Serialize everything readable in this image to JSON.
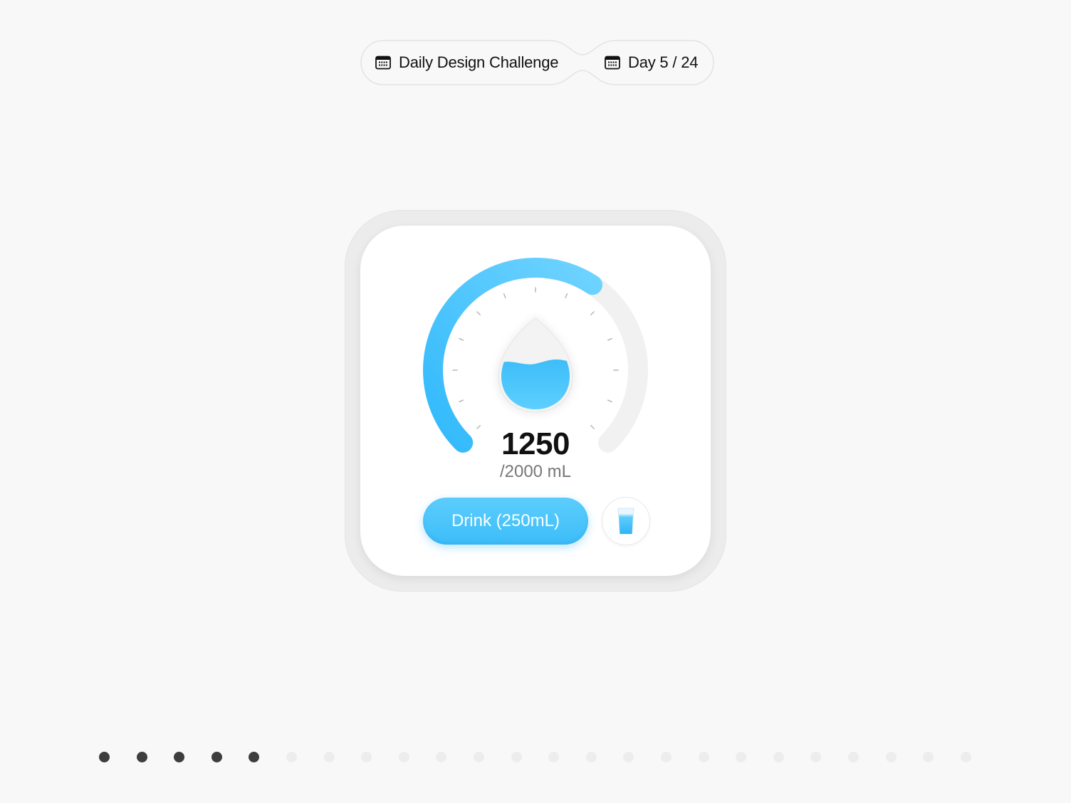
{
  "header": {
    "challenge_label": "Daily Design Challenge",
    "challenge_icon": "calendar-icon",
    "day_label": "Day 5 / 24",
    "day_icon": "calendar-icon"
  },
  "widget": {
    "intake_value": "1250",
    "goal_label": "/2000 mL",
    "progress_fraction": 0.625,
    "drink_button_label": "Drink (250mL)",
    "glass_icon": "water-glass-icon",
    "drop_icon": "water-drop-icon",
    "colors": {
      "accent": "#3dbdf9",
      "accent_light": "#6fd3ff",
      "track": "#f1f1f1",
      "tick": "#b5b5b5"
    }
  },
  "pagination": {
    "current_day": 5,
    "total_days": 24,
    "done_color": "#3d3d3d",
    "todo_color": "#ededed"
  }
}
